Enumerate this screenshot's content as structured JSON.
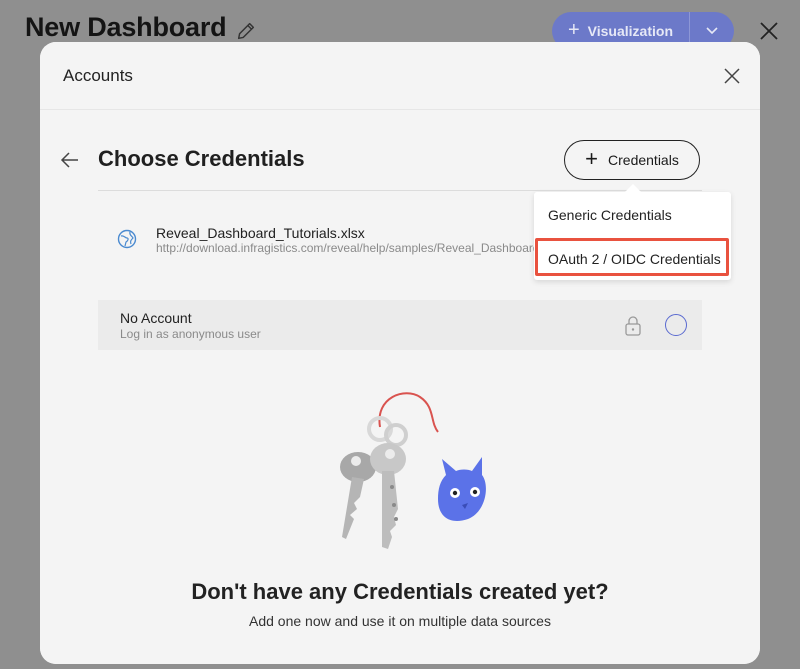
{
  "dashboard": {
    "title": "New Dashboard",
    "visualization_label": "Visualization"
  },
  "dialog": {
    "title": "Accounts",
    "heading": "Choose Credentials",
    "add_credentials_label": "Credentials"
  },
  "data_source": {
    "name": "Reveal_Dashboard_Tutorials.xlsx",
    "url": "http://download.infragistics.com/reveal/help/samples/Reveal_Dashboard_Tutorials.xlsx"
  },
  "account": {
    "title": "No Account",
    "subtitle": "Log in as anonymous user"
  },
  "dropdown": {
    "items": [
      "Generic Credentials",
      "OAuth 2 / OIDC Credentials"
    ]
  },
  "empty_state": {
    "title": "Don't have any Credentials created yet?",
    "subtitle": "Add one now and use it on multiple data sources"
  },
  "colors": {
    "accent": "#6c79c9",
    "highlight": "#e9523f",
    "cat": "#5b72e8"
  }
}
